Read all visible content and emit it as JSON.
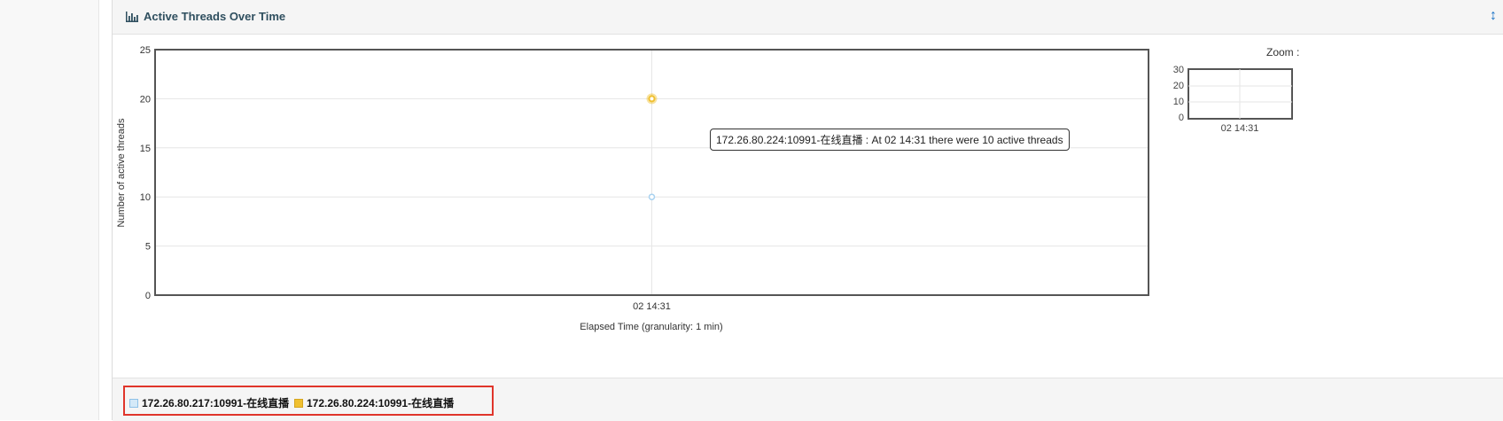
{
  "panel": {
    "title": "Active Threads Over Time",
    "icon": "bar-chart-icon",
    "expand_icon": "resize-vertical-icon"
  },
  "tooltip": {
    "text": "172.26.80.224:10991-在线直播 : At 02 14:31 there were 10 active threads"
  },
  "zoom": {
    "label": "Zoom :",
    "yticks": [
      "30",
      "20",
      "10",
      "0"
    ],
    "xtick": "02 14:31"
  },
  "colors": {
    "series1": "#a9d2f0",
    "series2": "#f0c030",
    "legend_highlight_border": "#e0352b",
    "grid": "#e6e6e6",
    "axis": "#555555"
  },
  "chart_data": {
    "type": "scatter",
    "title": "",
    "xlabel": "Elapsed Time (granularity: 1 min)",
    "ylabel": "Number of active threads",
    "ylim": [
      0,
      25
    ],
    "yticks": [
      0,
      5,
      10,
      15,
      20,
      25
    ],
    "x_categories": [
      "02 14:31"
    ],
    "grid": true,
    "legend_position": "bottom",
    "series": [
      {
        "name": "172.26.80.217:10991-在线直播",
        "x": [
          "02 14:31"
        ],
        "values": [
          10
        ]
      },
      {
        "name": "172.26.80.224:10991-在线直播",
        "x": [
          "02 14:31"
        ],
        "values": [
          20
        ]
      }
    ]
  }
}
